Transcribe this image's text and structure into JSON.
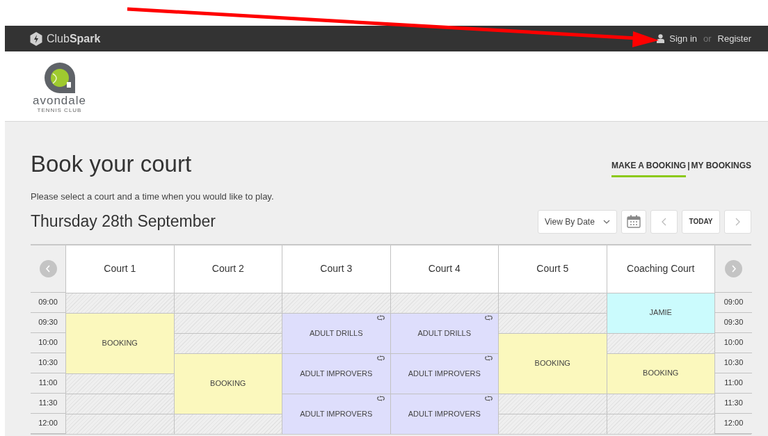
{
  "topbar": {
    "brand": "Club**Spark**",
    "sign_in": "Sign in",
    "or": "or",
    "register": "Register"
  },
  "club": {
    "name": "avondale",
    "tagline": "TENNIS CLUB"
  },
  "page": {
    "title": "Book your court",
    "subtitle": "Please select a court and a time when you would like to play.",
    "date": "Thursday 28th September"
  },
  "tabs": [
    {
      "label": "MAKE A BOOKING",
      "selected": true
    },
    {
      "label": "MY BOOKINGS",
      "selected": false
    }
  ],
  "tab_separator": "|",
  "controls": {
    "view": "View By Date",
    "today": "TODAY"
  },
  "times_left": [
    "09:00",
    "09:30",
    "10:00",
    "10:30",
    "11:00",
    "11:30",
    "12:00"
  ],
  "times_right": [
    "09:00",
    "09:30",
    "10:00",
    "10:30",
    "11:00",
    "11:30",
    "12:00"
  ],
  "courts": [
    {
      "name": "Court 1",
      "slots": [
        {
          "kind": "closed",
          "joined": false
        },
        {
          "kind": "booking",
          "label": "BOOKING",
          "joined": false
        },
        {
          "joined": true
        },
        {
          "joined": true
        },
        {
          "kind": "closed",
          "joined": false
        },
        {
          "kind": "closed",
          "joined": false
        },
        {
          "kind": "closed",
          "joined": false
        }
      ]
    },
    {
      "name": "Court 2",
      "slots": [
        {
          "kind": "closed",
          "joined": false
        },
        {
          "kind": "closed",
          "joined": false
        },
        {
          "kind": "closed",
          "joined": false
        },
        {
          "kind": "booking",
          "label": "BOOKING",
          "joined": false
        },
        {
          "joined": true
        },
        {
          "joined": true
        },
        {
          "kind": "closed",
          "joined": false
        }
      ]
    },
    {
      "name": "Court 3",
      "slots": [
        {
          "kind": "closed",
          "joined": false
        },
        {
          "kind": "class",
          "label": "ADULT DRILLS",
          "joined": false
        },
        {
          "joined": true
        },
        {
          "kind": "class",
          "label": "ADULT IMPROVERS",
          "joined": false
        },
        {
          "joined": true
        },
        {
          "kind": "class",
          "label": "ADULT IMPROVERS",
          "joined": false
        },
        {
          "joined": true
        }
      ]
    },
    {
      "name": "Court 4",
      "slots": [
        {
          "kind": "closed",
          "joined": false
        },
        {
          "kind": "class",
          "label": "ADULT DRILLS",
          "joined": false
        },
        {
          "joined": true
        },
        {
          "kind": "class",
          "label": "ADULT IMPROVERS",
          "joined": false
        },
        {
          "joined": true
        },
        {
          "kind": "class",
          "label": "ADULT IMPROVERS",
          "joined": false
        },
        {
          "joined": true
        }
      ]
    },
    {
      "name": "Court 5",
      "slots": [
        {
          "kind": "closed",
          "joined": false
        },
        {
          "kind": "closed",
          "joined": false
        },
        {
          "kind": "booking",
          "label": "BOOKING",
          "joined": false
        },
        {
          "joined": true
        },
        {
          "joined": true
        },
        {
          "kind": "closed",
          "joined": false
        },
        {
          "kind": "closed",
          "joined": false
        }
      ]
    },
    {
      "name": "Coaching Court",
      "slots": [
        {
          "kind": "coaching",
          "label": "JAMIE",
          "joined": false
        },
        {
          "joined": true
        },
        {
          "kind": "closed",
          "joined": false
        },
        {
          "kind": "booking",
          "label": "BOOKING",
          "joined": false
        },
        {
          "joined": true
        },
        {
          "kind": "closed",
          "joined": false
        },
        {
          "kind": "closed",
          "joined": false
        }
      ]
    }
  ]
}
